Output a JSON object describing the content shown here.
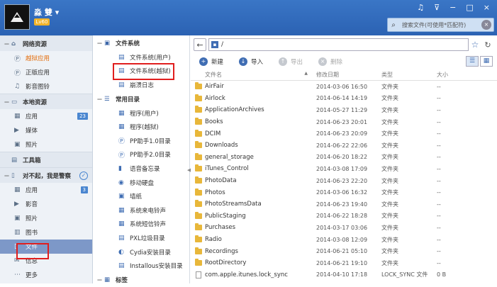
{
  "header": {
    "username": "淼 雙",
    "level": "Lv60",
    "search_placeholder": "搜索文件(可使用*匹配符)",
    "window_buttons": [
      "♫",
      "⊽",
      "−",
      "□",
      "×"
    ]
  },
  "left": {
    "sections": [
      {
        "label": "网络资源",
        "icon": "home-icon",
        "items": [
          {
            "label": "越狱应用",
            "icon": "pp-icon",
            "style": "orange"
          },
          {
            "label": "正版应用",
            "icon": "pp-icon"
          },
          {
            "label": "影音图铃",
            "icon": "ringtone-icon"
          }
        ]
      },
      {
        "label": "本地资源",
        "icon": "monitor-icon",
        "items": [
          {
            "label": "应用",
            "icon": "apps-icon",
            "badge": "23"
          },
          {
            "label": "媒体",
            "icon": "media-icon"
          },
          {
            "label": "照片",
            "icon": "photo-icon"
          }
        ]
      },
      {
        "label": "工具箱",
        "icon": "toolbox-icon",
        "items": []
      },
      {
        "label": "对不起，我是警察",
        "icon": "phone-icon",
        "items": [
          {
            "label": "应用",
            "icon": "apps-icon",
            "badge": "3"
          },
          {
            "label": "影音",
            "icon": "media-icon"
          },
          {
            "label": "照片",
            "icon": "photo-icon"
          },
          {
            "label": "图书",
            "icon": "book-icon"
          },
          {
            "label": "文件",
            "icon": "file-icon",
            "style": "active"
          },
          {
            "label": "信息",
            "icon": "message-icon"
          },
          {
            "label": "更多",
            "icon": "more-icon"
          }
        ]
      }
    ]
  },
  "middle": {
    "filesystem_title": "文件系统",
    "filesystem_items": [
      "文件系统(用户)",
      "文件系统(越狱)",
      "崩溃日志"
    ],
    "common_title": "常用目录",
    "common_items": [
      "程序(用户)",
      "程序(越狱)",
      "PP助手1.0目录",
      "PP助手2.0目录",
      "语音备忘录",
      "移动硬盘",
      "墙纸",
      "系统来电铃声",
      "系统短信铃声",
      "PXL垃圾目录",
      "Cydia安装目录",
      "Installous安装目录"
    ],
    "bookmarks_title": "标签"
  },
  "right": {
    "path": "/",
    "toolbar": {
      "new": "新建",
      "import": "导入",
      "export": "导出",
      "delete": "删除"
    },
    "columns": {
      "name": "文件名",
      "date": "修改日期",
      "type": "类型",
      "size": "大小"
    },
    "rows": [
      {
        "name": "AirFair",
        "date": "2014-03-06 16:50",
        "type": "文件夹",
        "size": "--",
        "kind": "folder"
      },
      {
        "name": "Airlock",
        "date": "2014-06-14 14:19",
        "type": "文件夹",
        "size": "--",
        "kind": "folder"
      },
      {
        "name": "ApplicationArchives",
        "date": "2014-05-27 11:29",
        "type": "文件夹",
        "size": "--",
        "kind": "folder"
      },
      {
        "name": "Books",
        "date": "2014-06-23 20:01",
        "type": "文件夹",
        "size": "--",
        "kind": "folder"
      },
      {
        "name": "DCIM",
        "date": "2014-06-23 20:09",
        "type": "文件夹",
        "size": "--",
        "kind": "folder"
      },
      {
        "name": "Downloads",
        "date": "2014-06-22 22:06",
        "type": "文件夹",
        "size": "--",
        "kind": "folder"
      },
      {
        "name": "general_storage",
        "date": "2014-06-20 18:22",
        "type": "文件夹",
        "size": "--",
        "kind": "folder"
      },
      {
        "name": "iTunes_Control",
        "date": "2014-03-08 17:09",
        "type": "文件夹",
        "size": "--",
        "kind": "folder"
      },
      {
        "name": "PhotoData",
        "date": "2014-06-23 22:20",
        "type": "文件夹",
        "size": "--",
        "kind": "folder"
      },
      {
        "name": "Photos",
        "date": "2014-03-06 16:32",
        "type": "文件夹",
        "size": "--",
        "kind": "folder"
      },
      {
        "name": "PhotoStreamsData",
        "date": "2014-06-23 19:40",
        "type": "文件夹",
        "size": "--",
        "kind": "folder"
      },
      {
        "name": "PublicStaging",
        "date": "2014-06-22 18:28",
        "type": "文件夹",
        "size": "--",
        "kind": "folder"
      },
      {
        "name": "Purchases",
        "date": "2014-03-17 03:06",
        "type": "文件夹",
        "size": "--",
        "kind": "folder"
      },
      {
        "name": "Radio",
        "date": "2014-03-08 12:09",
        "type": "文件夹",
        "size": "--",
        "kind": "folder"
      },
      {
        "name": "Recordings",
        "date": "2014-06-21 05:10",
        "type": "文件夹",
        "size": "--",
        "kind": "folder"
      },
      {
        "name": "RootDirectory",
        "date": "2014-06-21 19:10",
        "type": "文件夹",
        "size": "--",
        "kind": "folder"
      },
      {
        "name": "com.apple.itunes.lock_sync",
        "date": "2014-04-10 17:18",
        "type": "LOCK_SYNC 文件",
        "size": "0 B",
        "kind": "file"
      }
    ]
  }
}
